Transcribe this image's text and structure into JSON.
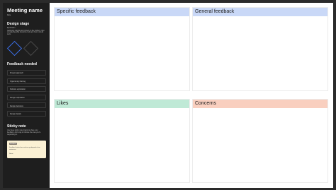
{
  "sidebar": {
    "meeting_name": "Meeting name",
    "meeting_subtitle": "Date",
    "design_stage": {
      "heading": "Design stage",
      "subheading": "Exploration",
      "description": "Gathering insights and context on the problem, then considering what should be built and how it should work."
    },
    "feedback_needed": {
      "heading": "Feedback needed",
      "items": [
        "Project approach",
        "Opportunity framing",
        "Solution exploration",
        "Design exploration",
        "Design decisions",
        "Design details"
      ]
    },
    "sticky_note": {
      "heading": "Sticky note",
      "description": "Use these sticky notes below to share your feedback. Add a tag to indicate the area you're responding to.",
      "tag": "Feedback",
      "text": "Feedback starts here and can go beyond a few sentences.",
      "author": "Name"
    }
  },
  "board": {
    "quadrants": [
      {
        "label": "Specific feedback",
        "color": "#c9d8f7"
      },
      {
        "label": "General feedback",
        "color": "#c9d8f7"
      },
      {
        "label": "Likes",
        "color": "#bfe9d6"
      },
      {
        "label": "Concerns",
        "color": "#f9cfbf"
      }
    ]
  },
  "colors": {
    "sidebar_bg": "#1e1e1e",
    "accent": "#3b6fe8",
    "sticky_bg": "#fbf1d4"
  }
}
